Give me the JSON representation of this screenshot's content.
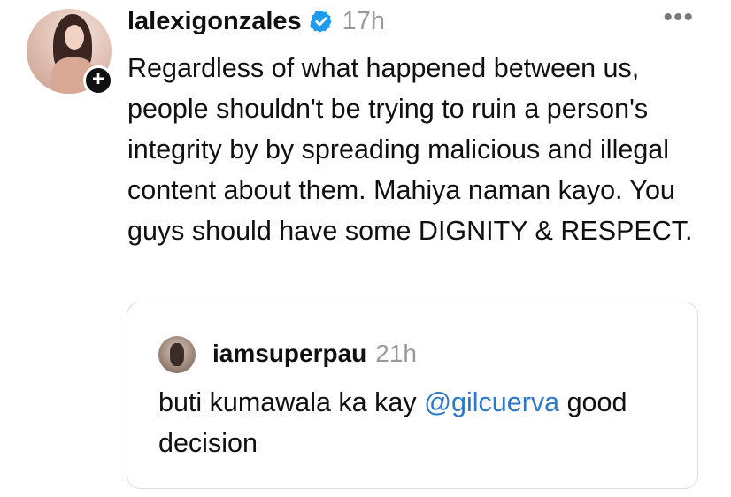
{
  "post": {
    "username": "lalexigonzales",
    "time": "17h",
    "more_icon": "more-horizontal-icon",
    "text": "Regardless of what happened between us, people shouldn't be trying to ruin a person's integrity by by spreading malicious and illegal content about them. Mahiya naman kayo. You guys should have some DIGNITY & RESPECT."
  },
  "quote": {
    "username": "iamsuperpau",
    "time": "21h",
    "text_before": "buti kumawala ka kay ",
    "mention": "@gilcuerva",
    "text_after": " good decision"
  },
  "colors": {
    "verified": "#1d9bf0",
    "mention": "#2f78c8",
    "muted": "#9a9a9a"
  }
}
